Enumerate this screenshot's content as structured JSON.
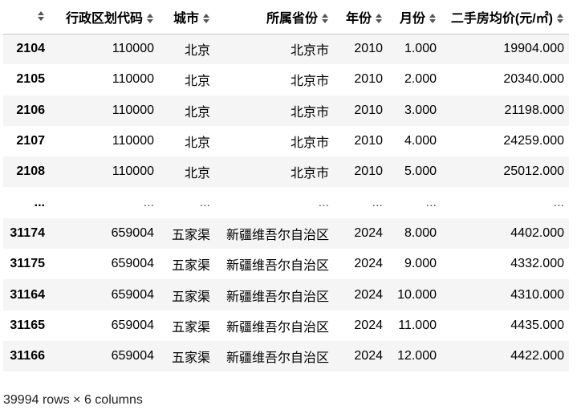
{
  "table": {
    "columns": [
      "行政区划代码",
      "城市",
      "所属省份",
      "年份",
      "月份",
      "二手房均价(元/㎡)"
    ],
    "rows": [
      {
        "index": "2104",
        "cells": [
          "110000",
          "北京",
          "北京市",
          "2010",
          "1.000",
          "19904.000"
        ]
      },
      {
        "index": "2105",
        "cells": [
          "110000",
          "北京",
          "北京市",
          "2010",
          "2.000",
          "20340.000"
        ]
      },
      {
        "index": "2106",
        "cells": [
          "110000",
          "北京",
          "北京市",
          "2010",
          "3.000",
          "21198.000"
        ]
      },
      {
        "index": "2107",
        "cells": [
          "110000",
          "北京",
          "北京市",
          "2010",
          "4.000",
          "24259.000"
        ]
      },
      {
        "index": "2108",
        "cells": [
          "110000",
          "北京",
          "北京市",
          "2010",
          "5.000",
          "25012.000"
        ]
      },
      {
        "index": "...",
        "cells": [
          "...",
          "...",
          "...",
          "...",
          "...",
          "..."
        ]
      },
      {
        "index": "31174",
        "cells": [
          "659004",
          "五家渠",
          "新疆维吾尔自治区",
          "2024",
          "8.000",
          "4402.000"
        ]
      },
      {
        "index": "31175",
        "cells": [
          "659004",
          "五家渠",
          "新疆维吾尔自治区",
          "2024",
          "9.000",
          "4332.000"
        ]
      },
      {
        "index": "31164",
        "cells": [
          "659004",
          "五家渠",
          "新疆维吾尔自治区",
          "2024",
          "10.000",
          "4310.000"
        ]
      },
      {
        "index": "31165",
        "cells": [
          "659004",
          "五家渠",
          "新疆维吾尔自治区",
          "2024",
          "11.000",
          "4435.000"
        ]
      },
      {
        "index": "31166",
        "cells": [
          "659004",
          "五家渠",
          "新疆维吾尔自治区",
          "2024",
          "12.000",
          "4422.000"
        ]
      }
    ]
  },
  "footer": {
    "shape": "39994 rows × 6 columns"
  },
  "icons": {
    "sort": "sort-updown-icon"
  }
}
